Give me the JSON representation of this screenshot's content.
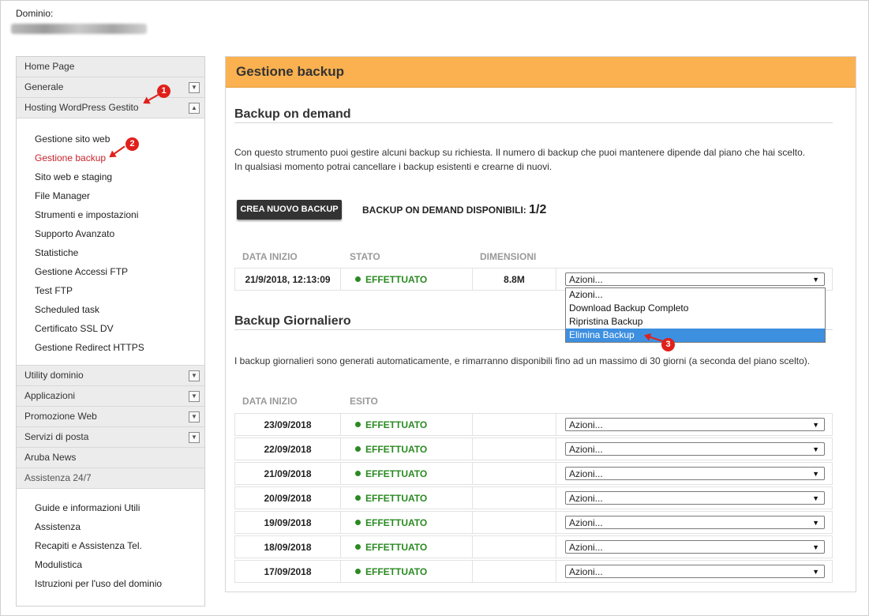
{
  "domain": {
    "label": "Dominio:"
  },
  "sidebar": {
    "top_items": [
      {
        "label": "Home Page"
      },
      {
        "label": "Generale",
        "toggle": "down"
      },
      {
        "label": "Hosting WordPress Gestito",
        "toggle": "up"
      }
    ],
    "hosting_sub": [
      {
        "label": "Gestione sito web"
      },
      {
        "label": "Gestione backup",
        "active": true
      },
      {
        "label": "Sito web e staging"
      },
      {
        "label": "File Manager"
      },
      {
        "label": "Strumenti e impostazioni"
      },
      {
        "label": "Supporto Avanzato"
      },
      {
        "label": "Statistiche"
      },
      {
        "label": "Gestione Accessi FTP"
      },
      {
        "label": "Test FTP"
      },
      {
        "label": "Scheduled task"
      },
      {
        "label": "Certificato SSL DV"
      },
      {
        "label": "Gestione Redirect HTTPS"
      }
    ],
    "mid_items": [
      {
        "label": "Utility dominio",
        "toggle": "down"
      },
      {
        "label": "Applicazioni",
        "toggle": "down"
      },
      {
        "label": "Promozione Web",
        "toggle": "down"
      },
      {
        "label": "Servizi di posta",
        "toggle": "down"
      },
      {
        "label": "Aruba News"
      },
      {
        "label": "Assistenza 24/7"
      }
    ],
    "assist_sub": [
      {
        "label": "Guide e informazioni Utili"
      },
      {
        "label": "Assistenza"
      },
      {
        "label": "Recapiti e Assistenza Tel."
      },
      {
        "label": "Modulistica"
      },
      {
        "label": "Istruzioni per l'uso del dominio"
      }
    ]
  },
  "markers": [
    "1",
    "2",
    "3"
  ],
  "main": {
    "title": "Gestione backup",
    "on_demand": {
      "title": "Backup on demand",
      "desc_line1": "Con questo strumento puoi gestire alcuni backup su richiesta. Il numero di backup che puoi mantenere dipende dal piano che hai scelto.",
      "desc_line2": "In qualsiasi momento potrai cancellare i backup esistenti e crearne di nuovi.",
      "create_button": "CREA NUOVO BACKUP",
      "available_label": "BACKUP ON DEMAND DISPONIBILI:",
      "available_count": "1/2",
      "columns": {
        "start": "DATA INIZIO",
        "status": "STATO",
        "size": "DIMENSIONI"
      },
      "row": {
        "date": "21/9/2018, 12:13:09",
        "status": "EFFETTUATO",
        "size": "8.8M",
        "action": "Azioni..."
      },
      "dropdown_options": [
        "Azioni...",
        "Download Backup Completo",
        "Ripristina Backup",
        "Elimina Backup"
      ],
      "highlighted_option": "Elimina Backup"
    },
    "daily": {
      "title": "Backup Giornaliero",
      "desc": "I backup giornalieri sono generati automaticamente, e rimarranno disponibili fino ad un massimo di 30 giorni (a seconda del piano scelto).",
      "columns": {
        "start": "DATA INIZIO",
        "outcome": "ESITO"
      },
      "rows": [
        {
          "date": "23/09/2018",
          "status": "EFFETTUATO",
          "action": "Azioni..."
        },
        {
          "date": "22/09/2018",
          "status": "EFFETTUATO",
          "action": "Azioni..."
        },
        {
          "date": "21/09/2018",
          "status": "EFFETTUATO",
          "action": "Azioni..."
        },
        {
          "date": "20/09/2018",
          "status": "EFFETTUATO",
          "action": "Azioni..."
        },
        {
          "date": "19/09/2018",
          "status": "EFFETTUATO",
          "action": "Azioni..."
        },
        {
          "date": "18/09/2018",
          "status": "EFFETTUATO",
          "action": "Azioni..."
        },
        {
          "date": "17/09/2018",
          "status": "EFFETTUATO",
          "action": "Azioni..."
        }
      ]
    }
  },
  "colors": {
    "header": "#fbb14f",
    "active_link": "#c6242c",
    "success": "#2a8a22",
    "marker": "#e0201b",
    "highlight": "#3d8fe0"
  }
}
